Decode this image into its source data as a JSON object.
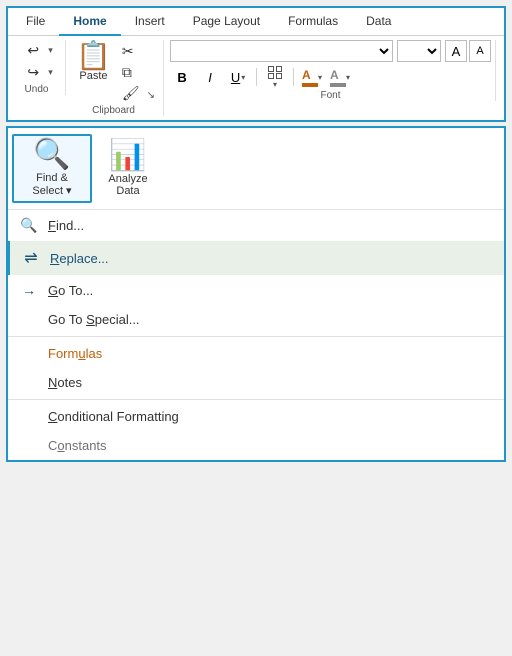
{
  "ribbon": {
    "tabs": [
      {
        "label": "File",
        "active": false
      },
      {
        "label": "Home",
        "active": true
      },
      {
        "label": "Insert",
        "active": false
      },
      {
        "label": "Page Layout",
        "active": false
      },
      {
        "label": "Formulas",
        "active": false
      },
      {
        "label": "Data",
        "active": false
      }
    ],
    "undo_group": {
      "label": "Undo",
      "undo_icon": "↩",
      "redo_icon": "↪"
    },
    "clipboard_group": {
      "label": "Clipboard",
      "paste_label": "Paste"
    },
    "font_group": {
      "label": "Font",
      "font_name_placeholder": "",
      "font_size_placeholder": "",
      "bold": "B",
      "italic": "I",
      "underline": "U"
    }
  },
  "lower_panel": {
    "find_select": {
      "label": "Find &\nSelect",
      "dropdown_arrow": "▾"
    },
    "analyze_data": {
      "label": "Analyze\nData"
    },
    "menu_items": [
      {
        "id": "find",
        "icon": "🔍",
        "text": "Find...",
        "style": "normal",
        "underline_char": "F"
      },
      {
        "id": "replace",
        "icon": "🔄",
        "text": "Replace...",
        "style": "highlighted",
        "underline_char": "R"
      },
      {
        "id": "goto",
        "icon": "→",
        "text": "Go To...",
        "style": "normal",
        "underline_char": "G",
        "is_arrow": true
      },
      {
        "id": "goto_special",
        "icon": "",
        "text": "Go To Special...",
        "style": "normal",
        "underline_char": "S"
      },
      {
        "id": "formulas",
        "icon": "",
        "text": "Formulas",
        "style": "orange",
        "underline_char": "u"
      },
      {
        "id": "notes",
        "icon": "",
        "text": "Notes",
        "style": "normal",
        "underline_char": "N"
      },
      {
        "id": "conditional_formatting",
        "icon": "",
        "text": "Conditional Formatting",
        "style": "normal",
        "underline_char": "C"
      },
      {
        "id": "constants",
        "icon": "",
        "text": "Constants",
        "style": "normal",
        "underline_char": "o"
      }
    ]
  }
}
